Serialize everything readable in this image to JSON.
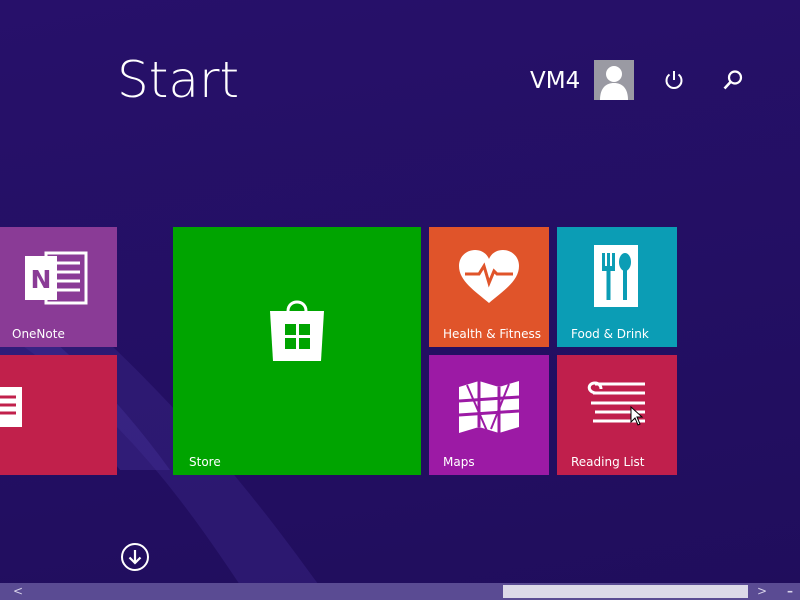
{
  "header": {
    "title": "Start",
    "user_name": "VM4",
    "avatar_icon": "user-silhouette-icon",
    "power_icon": "power-icon",
    "search_icon": "search-icon"
  },
  "tiles": {
    "onenote": {
      "label": "OneNote",
      "color": "#8a3b96",
      "icon": "onenote-icon"
    },
    "partial_red": {
      "label": "",
      "color": "#c1204b",
      "icon": "document-icon"
    },
    "store": {
      "label": "Store",
      "color": "#00a400",
      "icon": "store-bag-icon"
    },
    "health": {
      "label": "Health & Fitness",
      "color": "#e0542a",
      "icon": "heart-pulse-icon"
    },
    "food": {
      "label": "Food & Drink",
      "color": "#0b9db5",
      "icon": "fork-spoon-icon"
    },
    "maps": {
      "label": "Maps",
      "color": "#9c1aa5",
      "icon": "map-icon"
    },
    "reading": {
      "label": "Reading List",
      "color": "#c01f4c",
      "icon": "reading-list-icon"
    }
  },
  "footer": {
    "apps_arrow_icon": "arrow-down-circle-icon",
    "scroll_left_glyph": "<",
    "scroll_right_glyph": ">",
    "scroll_end_glyph": "–"
  }
}
